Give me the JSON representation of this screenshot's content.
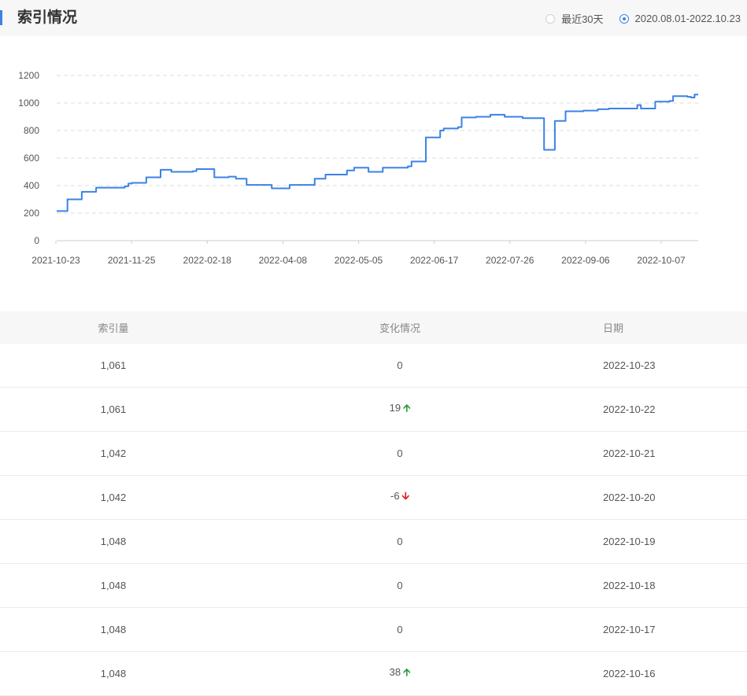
{
  "header": {
    "title": "索引情况",
    "options": [
      {
        "label": "最近30天",
        "checked": false
      },
      {
        "label": "2020.08.01-2022.10.23",
        "checked": true
      }
    ]
  },
  "chart_data": {
    "type": "line",
    "title": "",
    "xlabel": "",
    "ylabel": "",
    "ylim": [
      0,
      1200
    ],
    "yticks": [
      0,
      200,
      400,
      600,
      800,
      1000,
      1200
    ],
    "xticks": [
      "2021-10-23",
      "2021-11-25",
      "2022-02-18",
      "2022-04-08",
      "2022-05-05",
      "2022-06-17",
      "2022-07-26",
      "2022-09-06",
      "2022-10-07"
    ],
    "grid": true,
    "line_color": "#3b82e6",
    "series": [
      {
        "values": [
          215,
          215,
          215,
          300,
          300,
          300,
          300,
          355,
          355,
          355,
          355,
          385,
          385,
          385,
          385,
          385,
          385,
          385,
          385,
          395,
          415,
          420,
          420,
          420,
          420,
          460,
          460,
          460,
          460,
          515,
          515,
          515,
          500,
          500,
          500,
          500,
          500,
          500,
          505,
          520,
          520,
          520,
          520,
          520,
          460,
          460,
          460,
          460,
          465,
          465,
          450,
          450,
          450,
          405,
          405,
          405,
          405,
          405,
          405,
          405,
          380,
          380,
          380,
          380,
          380,
          405,
          405,
          405,
          405,
          405,
          405,
          405,
          450,
          450,
          450,
          480,
          480,
          480,
          480,
          480,
          480,
          510,
          510,
          530,
          530,
          530,
          530,
          500,
          500,
          500,
          500,
          530,
          530,
          530,
          530,
          530,
          530,
          530,
          540,
          575,
          575,
          575,
          575,
          750,
          750,
          750,
          750,
          800,
          815,
          815,
          815,
          815,
          825,
          895,
          895,
          895,
          895,
          900,
          900,
          900,
          900,
          915,
          915,
          915,
          915,
          900,
          900,
          900,
          900,
          900,
          890,
          890,
          890,
          890,
          890,
          890,
          660,
          660,
          660,
          870,
          870,
          870,
          940,
          940,
          940,
          940,
          940,
          945,
          945,
          945,
          945,
          955,
          955,
          955,
          960,
          960,
          960,
          960,
          960,
          960,
          960,
          960,
          985,
          960,
          960,
          960,
          960,
          1010,
          1010,
          1010,
          1010,
          1015,
          1050,
          1050,
          1050,
          1050,
          1045,
          1040,
          1061,
          1061
        ]
      }
    ]
  },
  "table": {
    "headers": [
      "索引量",
      "变化情况",
      "日期"
    ],
    "rows": [
      {
        "count": "1,061",
        "change": "0",
        "trend": "",
        "date": "2022-10-23"
      },
      {
        "count": "1,061",
        "change": "19",
        "trend": "up",
        "date": "2022-10-22"
      },
      {
        "count": "1,042",
        "change": "0",
        "trend": "",
        "date": "2022-10-21"
      },
      {
        "count": "1,042",
        "change": "-6",
        "trend": "down",
        "date": "2022-10-20"
      },
      {
        "count": "1,048",
        "change": "0",
        "trend": "",
        "date": "2022-10-19"
      },
      {
        "count": "1,048",
        "change": "0",
        "trend": "",
        "date": "2022-10-18"
      },
      {
        "count": "1,048",
        "change": "0",
        "trend": "",
        "date": "2022-10-17"
      },
      {
        "count": "1,048",
        "change": "38",
        "trend": "up",
        "date": "2022-10-16"
      }
    ]
  }
}
